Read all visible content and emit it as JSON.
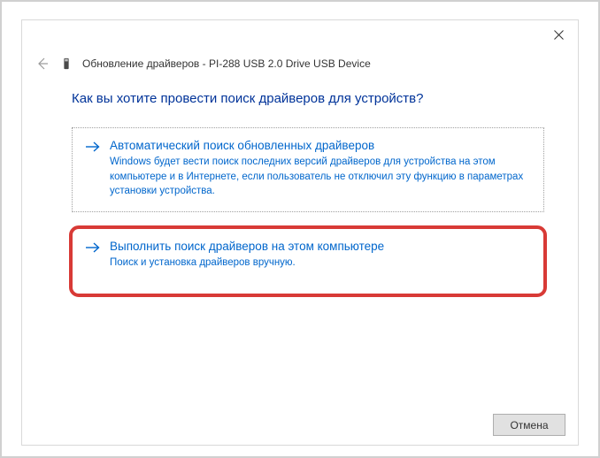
{
  "header": {
    "title_prefix": "Обновление драйверов",
    "device_name": "PI-288 USB 2.0 Drive USB Device"
  },
  "question": "Как вы хотите провести поиск драйверов для устройств?",
  "options": {
    "auto": {
      "title": "Автоматический поиск обновленных драйверов",
      "desc": "Windows будет вести поиск последних версий драйверов для устройства на этом компьютере и в Интернете, если пользователь не отключил эту функцию в параметрах установки устройства."
    },
    "manual": {
      "title": "Выполнить поиск драйверов на этом компьютере",
      "desc": "Поиск и установка драйверов вручную."
    }
  },
  "buttons": {
    "cancel": "Отмена"
  }
}
